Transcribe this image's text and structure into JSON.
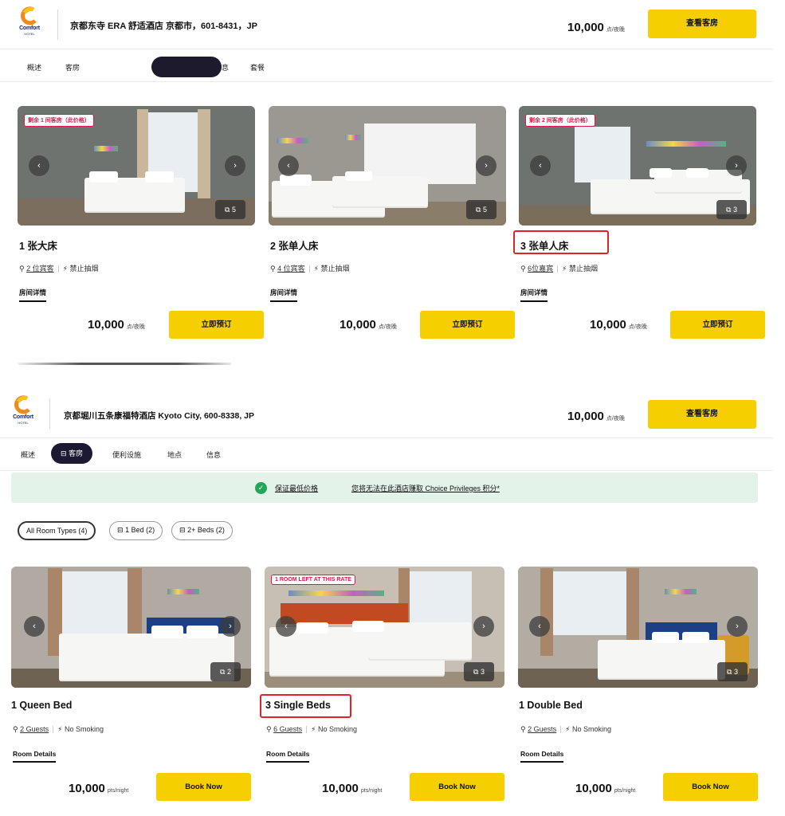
{
  "top": {
    "logo": {
      "brand": "Comfort",
      "sub": "HOTEL"
    },
    "title": "京都东寺 ERA 舒适酒店  京都市，601-8431，JP",
    "price": "10,000",
    "price_unit": "点/夜晚",
    "cta": "查看客房",
    "nav": [
      "概述",
      "客房",
      "息",
      "套餐"
    ],
    "rooms": [
      {
        "badge": "剩余 1 间客房（此价格）",
        "name": "1 张大床",
        "guests": "2 位宾客",
        "smoking": "禁止抽烟",
        "details": "房间详情",
        "price": "10,000",
        "unit": "点/夜晚",
        "button": "立即预订",
        "photos": "5"
      },
      {
        "badge": "",
        "name": "2 张单人床",
        "guests": "4 位宾客",
        "smoking": "禁止抽烟",
        "details": "房间详情",
        "price": "10,000",
        "unit": "点/夜晚",
        "button": "立即预订",
        "photos": "5"
      },
      {
        "badge": "剩余 2 间客房（此价格）",
        "name": "3 张单人床",
        "guests": "6位嘉宾",
        "smoking": "禁止抽烟",
        "details": "房间详情",
        "price": "10,000",
        "unit": "点/夜晚",
        "button": "立即预订",
        "photos": "3"
      }
    ]
  },
  "bottom": {
    "logo": {
      "brand": "Comfort",
      "sub": "HOTEL"
    },
    "title": "京都堀川五条康福特酒店  Kyoto City, 600-8338, JP",
    "price": "10,000",
    "price_unit": "点/夜晚",
    "cta": "查看客房",
    "nav": [
      "概述",
      "客房",
      "便利设施",
      "地点",
      "信息"
    ],
    "banner": {
      "best_price": "保证最低价格",
      "note": "您将无法在此酒店赚取 Choice Privileges 积分*"
    },
    "filters": [
      "All Room Types (4)",
      "1 Bed (2)",
      "2+ Beds (2)"
    ],
    "rooms": [
      {
        "badge": "",
        "name": "1 Queen Bed",
        "guests": "2 Guests",
        "smoking": "No Smoking",
        "details": "Room Details",
        "price": "10,000",
        "unit": "pts/night",
        "button": "Book Now",
        "photos": "2"
      },
      {
        "badge": "1 ROOM LEFT AT THIS RATE",
        "name": "3 Single Beds",
        "guests": "6 Guests",
        "smoking": "No Smoking",
        "details": "Room Details",
        "price": "10,000",
        "unit": "pts/night",
        "button": "Book Now",
        "photos": "3"
      },
      {
        "badge": "",
        "name": "1 Double Bed",
        "guests": "2 Guests",
        "smoking": "No Smoking",
        "details": "Room Details",
        "price": "10,000",
        "unit": "pts/night",
        "button": "Book Now",
        "photos": "3"
      }
    ]
  },
  "colors": {
    "accent": "#f6cf00",
    "highlight": "#e0222a",
    "badge": "#e0174a",
    "nav_active": "#1c1a33",
    "banner_bg": "#e3f3ea",
    "check": "#23a55a"
  }
}
